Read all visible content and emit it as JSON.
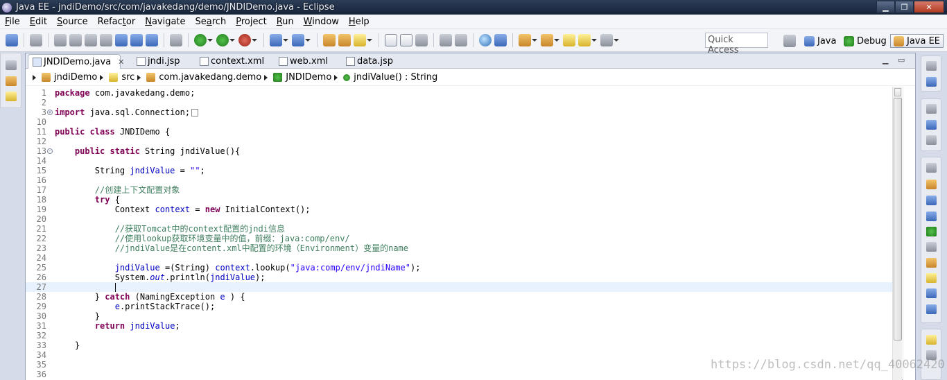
{
  "window": {
    "title": "Java EE - jndiDemo/src/com/javakedang/demo/JNDIDemo.java - Eclipse"
  },
  "menu": [
    {
      "mnemonic": "F",
      "rest": "ile"
    },
    {
      "mnemonic": "E",
      "rest": "dit"
    },
    {
      "mnemonic": "S",
      "rest": "ource"
    },
    {
      "pre": "Refac",
      "mnemonic": "t",
      "rest": "or"
    },
    {
      "mnemonic": "N",
      "rest": "avigate"
    },
    {
      "pre": "Se",
      "mnemonic": "a",
      "rest": "rch"
    },
    {
      "mnemonic": "P",
      "rest": "roject"
    },
    {
      "mnemonic": "R",
      "rest": "un"
    },
    {
      "mnemonic": "W",
      "rest": "indow"
    },
    {
      "mnemonic": "H",
      "rest": "elp"
    }
  ],
  "toolbar": {
    "quick_access_placeholder": "Quick Access",
    "perspectives": [
      "Java",
      "Debug",
      "Java EE"
    ]
  },
  "tabs": [
    "JNDIDemo.java",
    "jndi.jsp",
    "context.xml",
    "web.xml",
    "data.jsp"
  ],
  "breadcrumb": [
    "jndiDemo",
    "src",
    "com.javakedang.demo",
    "JNDIDemo",
    "jndiValue() : String"
  ],
  "code_lines": [
    {
      "n": "1",
      "segs": [
        [
          "kw",
          "package"
        ],
        [
          "",
          "com.javakedang.demo;"
        ]
      ]
    },
    {
      "n": "2",
      "segs": []
    },
    {
      "n": "3",
      "fold": "+",
      "segs": [
        [
          "kw",
          "import"
        ],
        [
          "",
          "java.sql.Connection;"
        ]
      ],
      "foldbox": true
    },
    {
      "n": "10",
      "segs": []
    },
    {
      "n": "11",
      "segs": [
        [
          "kw",
          "public class"
        ],
        [
          "",
          " JNDIDemo {"
        ]
      ]
    },
    {
      "n": "12",
      "segs": []
    },
    {
      "n": "13",
      "fold": "-",
      "segs": [
        [
          "",
          "    "
        ],
        [
          "kw",
          "public static"
        ],
        [
          "",
          " String jndiValue(){"
        ]
      ]
    },
    {
      "n": "14",
      "segs": []
    },
    {
      "n": "15",
      "segs": [
        [
          "",
          "        String "
        ],
        [
          "fld",
          "jndiValue"
        ],
        [
          "",
          " = "
        ],
        [
          "str",
          "\"\""
        ],
        [
          "",
          ";"
        ]
      ]
    },
    {
      "n": "16",
      "segs": []
    },
    {
      "n": "17",
      "segs": [
        [
          "cmt",
          "        //创建上下文配置对象"
        ]
      ]
    },
    {
      "n": "18",
      "segs": [
        [
          "",
          "        "
        ],
        [
          "kw",
          "try"
        ],
        [
          "",
          " {"
        ]
      ]
    },
    {
      "n": "19",
      "segs": [
        [
          "",
          "            Context "
        ],
        [
          "fld",
          "context"
        ],
        [
          "",
          " = "
        ],
        [
          "kw",
          "new"
        ],
        [
          "",
          " InitialContext();"
        ]
      ]
    },
    {
      "n": "20",
      "segs": []
    },
    {
      "n": "21",
      "segs": [
        [
          "cmt",
          "            //获取Tomcat中的context配置的jndi信息"
        ]
      ]
    },
    {
      "n": "22",
      "segs": [
        [
          "cmt",
          "            //使用lookup获取环境变量中的值，前缀：java:comp/env/"
        ]
      ]
    },
    {
      "n": "23",
      "segs": [
        [
          "cmt",
          "            //jndiValue是在content.xml中配置的环境（Environment）变量的name"
        ]
      ]
    },
    {
      "n": "24",
      "segs": []
    },
    {
      "n": "25",
      "segs": [
        [
          "",
          "            "
        ],
        [
          "fld",
          "jndiValue"
        ],
        [
          "",
          " =(String) "
        ],
        [
          "fld",
          "context"
        ],
        [
          "",
          ".lookup("
        ],
        [
          "str",
          "\"java:comp/env/jndiName\""
        ],
        [
          "",
          ");"
        ]
      ]
    },
    {
      "n": "26",
      "segs": [
        [
          "",
          "            System."
        ],
        [
          "sfld",
          "out"
        ],
        [
          "",
          ".println("
        ],
        [
          "fld",
          "jndiValue"
        ],
        [
          "",
          ");"
        ]
      ]
    },
    {
      "n": "27",
      "current": true,
      "caret": true,
      "segs": [
        [
          "",
          "            "
        ]
      ]
    },
    {
      "n": "28",
      "segs": [
        [
          "",
          "        } "
        ],
        [
          "kw",
          "catch"
        ],
        [
          "",
          " (NamingException "
        ],
        [
          "fld",
          "e"
        ],
        [
          "",
          " ) {"
        ]
      ]
    },
    {
      "n": "29",
      "segs": [
        [
          "",
          "            "
        ],
        [
          "fld",
          "e"
        ],
        [
          "",
          ".printStackTrace();"
        ]
      ]
    },
    {
      "n": "30",
      "segs": [
        [
          "",
          "        }"
        ]
      ]
    },
    {
      "n": "31",
      "segs": [
        [
          "",
          "        "
        ],
        [
          "kw",
          "return"
        ],
        [
          "",
          " "
        ],
        [
          "fld",
          "jndiValue"
        ],
        [
          "",
          ";"
        ]
      ]
    },
    {
      "n": "32",
      "segs": []
    },
    {
      "n": "33",
      "segs": [
        [
          "",
          "    }"
        ]
      ]
    },
    {
      "n": "34",
      "segs": []
    },
    {
      "n": "35",
      "segs": []
    },
    {
      "n": "36",
      "segs": []
    }
  ],
  "watermark": "https://blog.csdn.net/qq_40062420"
}
